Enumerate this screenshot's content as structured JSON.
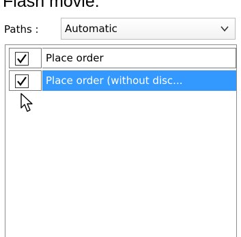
{
  "header": {
    "title": "Flash movie:"
  },
  "paths": {
    "label": "Paths :",
    "selected": "Automatic",
    "chevron_icon": "chevron-down-icon"
  },
  "list": {
    "items": [
      {
        "checked": true,
        "label": "Place order",
        "selected": false
      },
      {
        "checked": true,
        "label": "Place order (without disc...",
        "selected": true
      }
    ]
  },
  "colors": {
    "selection": "#3399ff",
    "selection_text": "#ffffff"
  }
}
